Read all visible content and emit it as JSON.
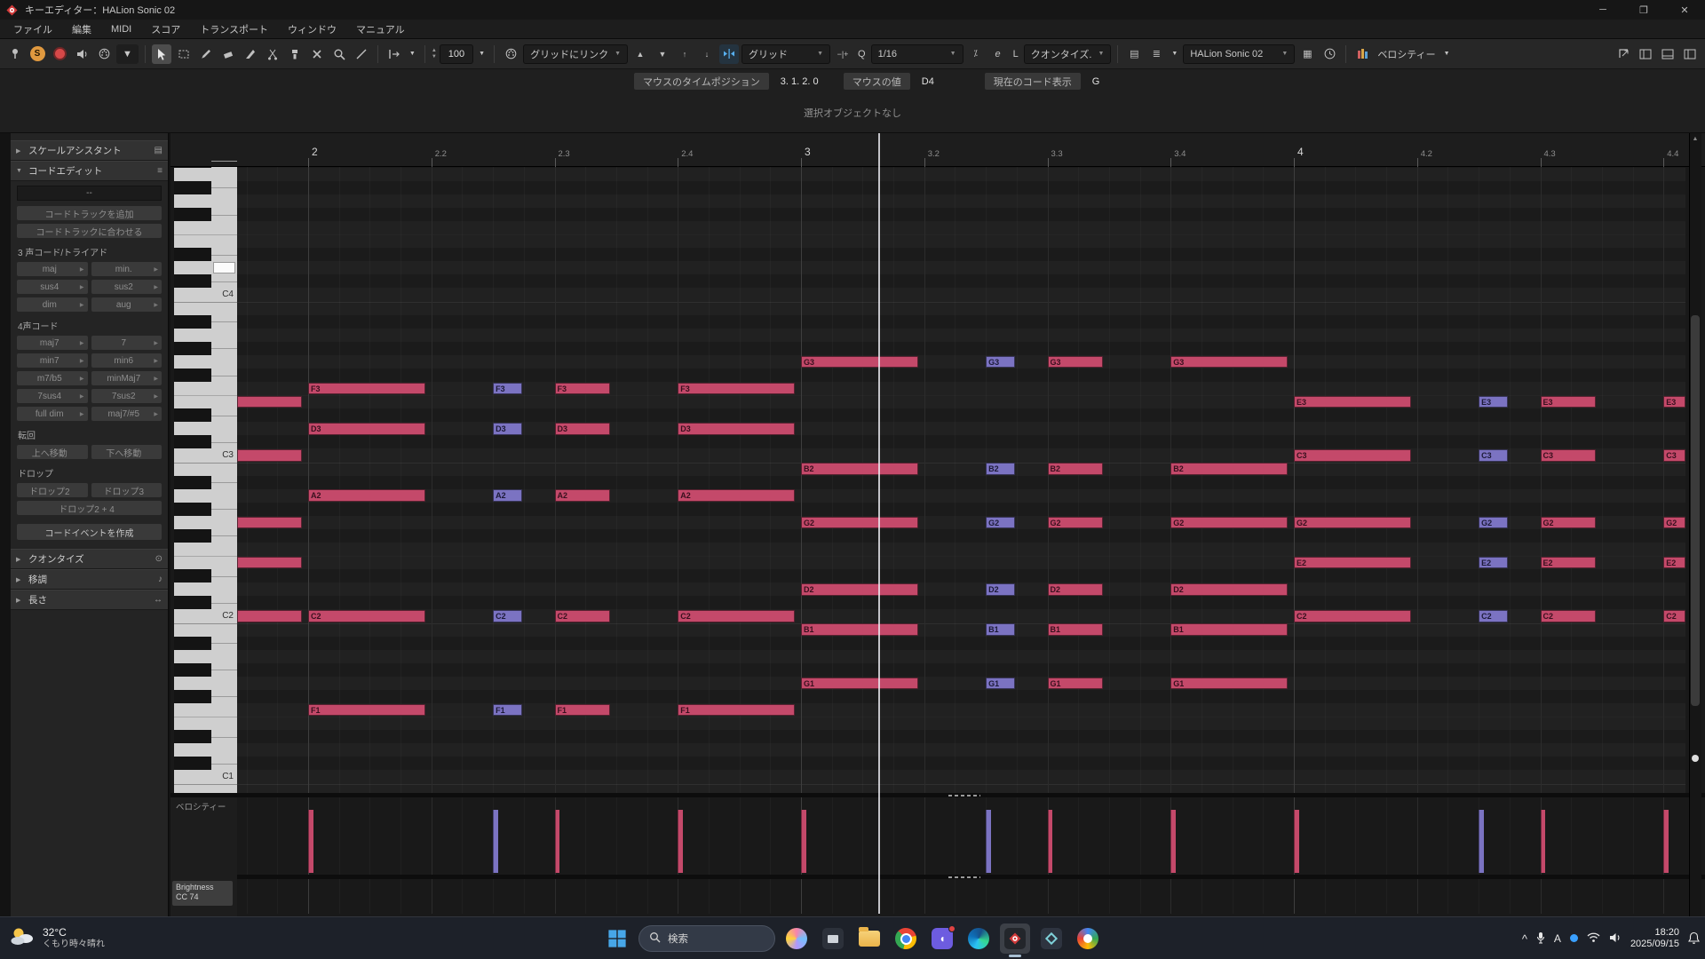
{
  "window": {
    "title": "キーエディター：HALion Sonic 02"
  },
  "menu": [
    "ファイル",
    "編集",
    "MIDI",
    "スコア",
    "トランスポート",
    "ウィンドウ",
    "マニュアル"
  ],
  "toolbar": {
    "left_icons": [
      "pin-icon",
      "solo-button",
      "record-button",
      "feedback-icon",
      "input-icon"
    ],
    "tools": [
      "select-tool",
      "range-tool",
      "draw-tool",
      "erase-tool",
      "trim-tool",
      "split-tool",
      "glue-tool",
      "mute-tool",
      "zoom-tool",
      "line-tool"
    ],
    "active_tool": "select-tool",
    "insert_velocity": "100",
    "grid_link": "グリッドにリンク",
    "snap_on": true,
    "snap_type": "グリッド",
    "q_label": "Q",
    "quantize_value": "1/16",
    "quantize_panel_glyph": "e",
    "length_q_label": "L",
    "length_q_value": "クオンタイズ.",
    "part_selector": "HALion Sonic 02",
    "event_colors": "ベロシティー"
  },
  "info_line": {
    "fields": [
      {
        "label": "マウスのタイムポジション",
        "value": "3. 1. 2.  0"
      },
      {
        "label": "マウスの値",
        "value": "D4"
      },
      {
        "label": "現在のコード表示",
        "value": "G"
      }
    ]
  },
  "status_line": "選択オブジェクトなし",
  "sidebar": {
    "top_sections": [
      {
        "label": "スケールアシスタント",
        "collapsed": true,
        "icon": "keyboard-icon"
      },
      {
        "label": "コードエディット",
        "collapsed": false,
        "icon": "list-icon"
      }
    ],
    "chord_edit": {
      "current_chord": "--",
      "buttons": [
        "コードトラックを追加",
        "コードトラックに合わせる"
      ],
      "groups": [
        {
          "label": "3 声コード/トライアド",
          "arrow": true,
          "items": [
            "maj",
            "min.",
            "sus4",
            "sus2",
            "dim",
            "aug"
          ]
        },
        {
          "label": "4声コード",
          "arrow": true,
          "items": [
            "maj7",
            "7",
            "min7",
            "min6",
            "m7/b5",
            "minMaj7",
            "7sus4",
            "7sus2",
            "full dim",
            "maj7/#5"
          ]
        },
        {
          "label": "転回",
          "arrow": false,
          "items": [
            "上へ移動",
            "下へ移動"
          ]
        },
        {
          "label": "ドロップ",
          "arrow": false,
          "items": [
            "ドロップ2",
            "ドロップ3"
          ],
          "extra": "ドロップ2 + 4"
        }
      ],
      "create_button": "コードイベントを作成"
    },
    "bottom_sections": [
      {
        "label": "クオンタイズ",
        "icon": "magnifier-icon"
      },
      {
        "label": "移調",
        "icon": "note-icon"
      },
      {
        "label": "長さ",
        "icon": "length-icon"
      }
    ]
  },
  "editor": {
    "ruler": [
      {
        "b": 0,
        "t": "2"
      },
      {
        "b": 1,
        "t": "2.2"
      },
      {
        "b": 2,
        "t": "2.3"
      },
      {
        "b": 3,
        "t": "2.4"
      },
      {
        "b": 4,
        "t": "3"
      },
      {
        "b": 5,
        "t": "3.2"
      },
      {
        "b": 6,
        "t": "3.3"
      },
      {
        "b": 7,
        "t": "3.4"
      },
      {
        "b": 8,
        "t": "4"
      },
      {
        "b": 9,
        "t": "4.2"
      },
      {
        "b": 10,
        "t": "4.3"
      },
      {
        "b": 11,
        "t": "4.4"
      }
    ],
    "key_labels": [
      "C1",
      "C2",
      "C3",
      "C4"
    ],
    "highlighted_key": "D4",
    "playhead_beat": 4.63,
    "chords": [
      {
        "bar": 1,
        "labeled": false,
        "pitches": [
          "E3",
          "C3",
          "G2",
          "E2",
          "C2"
        ],
        "events": [
          {
            "off": 3,
            "len": 0.95,
            "sel": false
          }
        ]
      },
      {
        "bar": 2,
        "pitches": [
          "F3",
          "D3",
          "A2",
          "C2",
          "F1"
        ],
        "events": [
          {
            "off": 0,
            "len": 0.95,
            "sel": false
          },
          {
            "off": 1.5,
            "len": 0.24,
            "sel": true
          },
          {
            "off": 2,
            "len": 0.45,
            "sel": false
          },
          {
            "off": 3,
            "len": 0.95,
            "sel": false
          }
        ]
      },
      {
        "bar": 3,
        "pitches": [
          "G3",
          "B2",
          "G2",
          "D2",
          "B1",
          "G1"
        ],
        "events": [
          {
            "off": 0,
            "len": 0.95,
            "sel": false
          },
          {
            "off": 1.5,
            "len": 0.24,
            "sel": true
          },
          {
            "off": 2,
            "len": 0.45,
            "sel": false
          },
          {
            "off": 3,
            "len": 0.95,
            "sel": false
          }
        ]
      },
      {
        "bar": 4,
        "pitches": [
          "E3",
          "C3",
          "G2",
          "E2",
          "C2"
        ],
        "events": [
          {
            "off": 0,
            "len": 0.95,
            "sel": false
          },
          {
            "off": 1.5,
            "len": 0.24,
            "sel": true
          },
          {
            "off": 2,
            "len": 0.45,
            "sel": false
          },
          {
            "off": 3,
            "len": 0.95,
            "sel": false
          }
        ]
      }
    ],
    "velocity_label": "ベロシティー",
    "cc_label": [
      "Brightness",
      "CC 74"
    ]
  },
  "taskbar": {
    "weather": {
      "icon": "sun-cloud-icon",
      "temp": "32°C",
      "desc": "くもり時々晴れ"
    },
    "search_placeholder": "検索",
    "apps": [
      "start",
      "search",
      "copilot",
      "taskview",
      "explorer",
      "chrome",
      "chat",
      "edge",
      "cubase",
      "box",
      "browser"
    ],
    "active_app": "cubase",
    "tray": [
      "chevron-up-icon",
      "mic-icon",
      "ime-icon",
      "bluetooth-icon",
      "wifi-icon",
      "volume-icon"
    ],
    "clock": {
      "time": "18:20",
      "date": "2025/09/15"
    },
    "bell": "bell-icon"
  },
  "colors": {
    "note": "#c4496a",
    "note_selected": "#7b73c2",
    "accent": "#58b0f0"
  }
}
